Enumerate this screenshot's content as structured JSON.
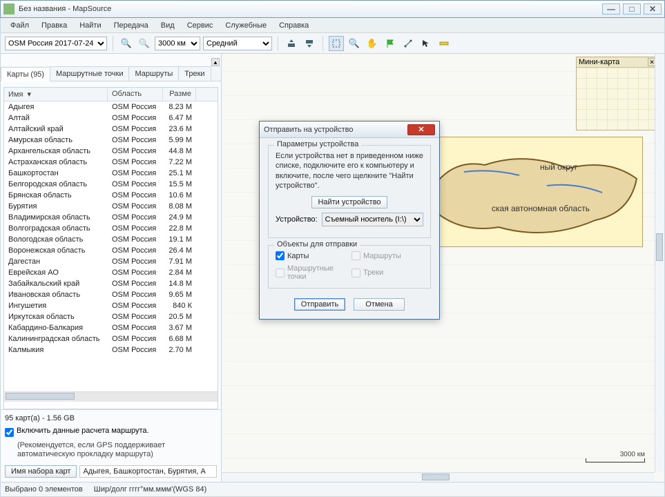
{
  "window": {
    "title": "Без названия - MapSource"
  },
  "menu": {
    "items": [
      "Файл",
      "Правка",
      "Найти",
      "Передача",
      "Вид",
      "Сервис",
      "Служебные",
      "Справка"
    ]
  },
  "toolbar": {
    "product": "OSM Россия 2017-07-24",
    "zoom": "3000 км",
    "detail": "Средний"
  },
  "sidebar": {
    "tabs": [
      {
        "label": "Карты (95)"
      },
      {
        "label": "Маршрутные точки"
      },
      {
        "label": "Маршруты"
      },
      {
        "label": "Треки"
      }
    ],
    "columns": {
      "name": "Имя",
      "region": "Область",
      "size": "Разме"
    },
    "rows": [
      {
        "name": "Адыгея",
        "region": "OSM Россия",
        "size": "8.23 М"
      },
      {
        "name": "Алтай",
        "region": "OSM Россия",
        "size": "6.47 М"
      },
      {
        "name": "Алтайский край",
        "region": "OSM Россия",
        "size": "23.6 М"
      },
      {
        "name": "Амурская область",
        "region": "OSM Россия",
        "size": "5.99 М"
      },
      {
        "name": "Архангельская область",
        "region": "OSM Россия",
        "size": "44.8 М"
      },
      {
        "name": "Астраханская область",
        "region": "OSM Россия",
        "size": "7.22 М"
      },
      {
        "name": "Башкортостан",
        "region": "OSM Россия",
        "size": "25.1 М"
      },
      {
        "name": "Белгородская область",
        "region": "OSM Россия",
        "size": "15.5 М"
      },
      {
        "name": "Брянская область",
        "region": "OSM Россия",
        "size": "10.6 М"
      },
      {
        "name": "Бурятия",
        "region": "OSM Россия",
        "size": "8.08 М"
      },
      {
        "name": "Владимирская область",
        "region": "OSM Россия",
        "size": "24.9 М"
      },
      {
        "name": "Волгоградская область",
        "region": "OSM Россия",
        "size": "22.8 М"
      },
      {
        "name": "Вологодская область",
        "region": "OSM Россия",
        "size": "19.1 М"
      },
      {
        "name": "Воронежская область",
        "region": "OSM Россия",
        "size": "26.4 М"
      },
      {
        "name": "Дагестан",
        "region": "OSM Россия",
        "size": "7.91 М"
      },
      {
        "name": "Еврейская АО",
        "region": "OSM Россия",
        "size": "2.84 М"
      },
      {
        "name": "Забайкальский край",
        "region": "OSM Россия",
        "size": "14.8 М"
      },
      {
        "name": "Ивановская область",
        "region": "OSM Россия",
        "size": "9.65 М"
      },
      {
        "name": "Ингушетия",
        "region": "OSM Россия",
        "size": "840 К"
      },
      {
        "name": "Иркутская область",
        "region": "OSM Россия",
        "size": "20.5 М"
      },
      {
        "name": "Кабардино-Балкария",
        "region": "OSM Россия",
        "size": "3.67 М"
      },
      {
        "name": "Калининградская область",
        "region": "OSM Россия",
        "size": "6.68 М"
      },
      {
        "name": "Калмыкия",
        "region": "OSM Россия",
        "size": "2.70 М"
      }
    ],
    "summary": "95 карт(а) - 1.56 GB",
    "routing_checkbox": "Включить данные расчета маршрута.",
    "routing_note": "(Рекомендуется, если GPS поддерживает автоматическую прокладку маршрута)",
    "mapset_button": "Имя набора карт",
    "mapset_value": "Адыгея, Башкортостан, Бурятия, А"
  },
  "map": {
    "minimap_title": "Мини-карта",
    "region_label_1": "ный округ",
    "region_label_2": "ская автономная область",
    "scale_label": "3000 км"
  },
  "dialog": {
    "title": "Отправить на устройство",
    "group1_legend": "Параметры устройства",
    "group1_desc": "Если устройства нет в приведенном ниже списке, подключите его к компьютеру и включите, после чего щелкните \"Найти устройство\".",
    "find_button": "Найти устройство",
    "device_label": "Устройство:",
    "device_value": "Съемный носитель (I:\\)",
    "group2_legend": "Объекты для отправки",
    "chk_maps": "Карты",
    "chk_routes": "Маршруты",
    "chk_waypoints": "Маршрутные точки",
    "chk_tracks": "Треки",
    "send_button": "Отправить",
    "cancel_button": "Отмена"
  },
  "statusbar": {
    "selection": "Выбрано 0 элементов",
    "coords": "Шир/долг гггг°мм.ммм'(WGS 84)"
  }
}
